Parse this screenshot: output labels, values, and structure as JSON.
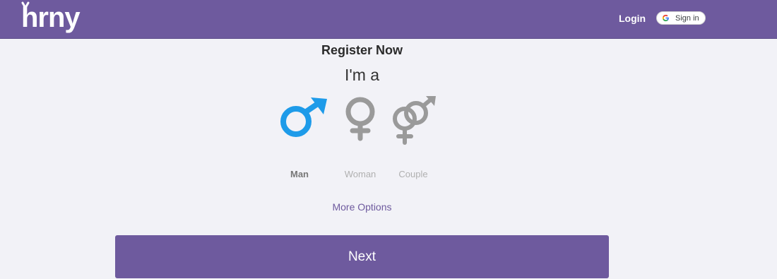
{
  "header": {
    "logo_text": "hrny",
    "login_label": "Login",
    "signin_label": "Sign in"
  },
  "register": {
    "title": "Register Now",
    "subtitle": "I'm a",
    "options": [
      {
        "label": "Man",
        "icon": "male-symbol-icon",
        "selected": true,
        "color": "#1e9be9"
      },
      {
        "label": "Woman",
        "icon": "female-symbol-icon",
        "selected": false,
        "color": "#9a9a9a"
      },
      {
        "label": "Couple",
        "icon": "couple-symbol-icon",
        "selected": false,
        "color": "#9a9a9a"
      }
    ],
    "more_options_label": "More Options",
    "next_label": "Next"
  },
  "colors": {
    "brand": "#6e5a9e",
    "background": "#f2f2f7",
    "selected_icon": "#1e9be9",
    "unselected_icon": "#9a9a9a"
  }
}
